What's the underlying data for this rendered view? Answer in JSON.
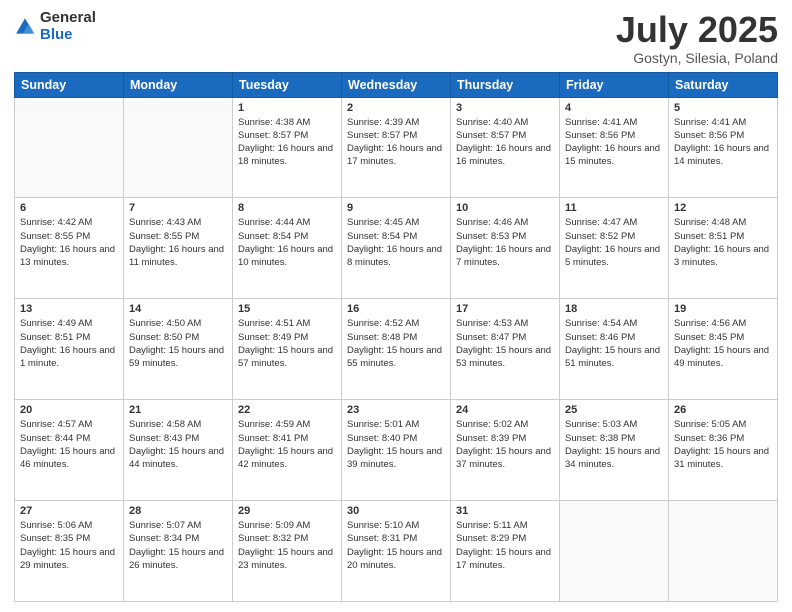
{
  "header": {
    "logo_general": "General",
    "logo_blue": "Blue",
    "month_title": "July 2025",
    "subtitle": "Gostyn, Silesia, Poland"
  },
  "weekdays": [
    "Sunday",
    "Monday",
    "Tuesday",
    "Wednesday",
    "Thursday",
    "Friday",
    "Saturday"
  ],
  "weeks": [
    [
      {
        "day": "",
        "detail": ""
      },
      {
        "day": "",
        "detail": ""
      },
      {
        "day": "1",
        "detail": "Sunrise: 4:38 AM\nSunset: 8:57 PM\nDaylight: 16 hours and 18 minutes."
      },
      {
        "day": "2",
        "detail": "Sunrise: 4:39 AM\nSunset: 8:57 PM\nDaylight: 16 hours and 17 minutes."
      },
      {
        "day": "3",
        "detail": "Sunrise: 4:40 AM\nSunset: 8:57 PM\nDaylight: 16 hours and 16 minutes."
      },
      {
        "day": "4",
        "detail": "Sunrise: 4:41 AM\nSunset: 8:56 PM\nDaylight: 16 hours and 15 minutes."
      },
      {
        "day": "5",
        "detail": "Sunrise: 4:41 AM\nSunset: 8:56 PM\nDaylight: 16 hours and 14 minutes."
      }
    ],
    [
      {
        "day": "6",
        "detail": "Sunrise: 4:42 AM\nSunset: 8:55 PM\nDaylight: 16 hours and 13 minutes."
      },
      {
        "day": "7",
        "detail": "Sunrise: 4:43 AM\nSunset: 8:55 PM\nDaylight: 16 hours and 11 minutes."
      },
      {
        "day": "8",
        "detail": "Sunrise: 4:44 AM\nSunset: 8:54 PM\nDaylight: 16 hours and 10 minutes."
      },
      {
        "day": "9",
        "detail": "Sunrise: 4:45 AM\nSunset: 8:54 PM\nDaylight: 16 hours and 8 minutes."
      },
      {
        "day": "10",
        "detail": "Sunrise: 4:46 AM\nSunset: 8:53 PM\nDaylight: 16 hours and 7 minutes."
      },
      {
        "day": "11",
        "detail": "Sunrise: 4:47 AM\nSunset: 8:52 PM\nDaylight: 16 hours and 5 minutes."
      },
      {
        "day": "12",
        "detail": "Sunrise: 4:48 AM\nSunset: 8:51 PM\nDaylight: 16 hours and 3 minutes."
      }
    ],
    [
      {
        "day": "13",
        "detail": "Sunrise: 4:49 AM\nSunset: 8:51 PM\nDaylight: 16 hours and 1 minute."
      },
      {
        "day": "14",
        "detail": "Sunrise: 4:50 AM\nSunset: 8:50 PM\nDaylight: 15 hours and 59 minutes."
      },
      {
        "day": "15",
        "detail": "Sunrise: 4:51 AM\nSunset: 8:49 PM\nDaylight: 15 hours and 57 minutes."
      },
      {
        "day": "16",
        "detail": "Sunrise: 4:52 AM\nSunset: 8:48 PM\nDaylight: 15 hours and 55 minutes."
      },
      {
        "day": "17",
        "detail": "Sunrise: 4:53 AM\nSunset: 8:47 PM\nDaylight: 15 hours and 53 minutes."
      },
      {
        "day": "18",
        "detail": "Sunrise: 4:54 AM\nSunset: 8:46 PM\nDaylight: 15 hours and 51 minutes."
      },
      {
        "day": "19",
        "detail": "Sunrise: 4:56 AM\nSunset: 8:45 PM\nDaylight: 15 hours and 49 minutes."
      }
    ],
    [
      {
        "day": "20",
        "detail": "Sunrise: 4:57 AM\nSunset: 8:44 PM\nDaylight: 15 hours and 46 minutes."
      },
      {
        "day": "21",
        "detail": "Sunrise: 4:58 AM\nSunset: 8:43 PM\nDaylight: 15 hours and 44 minutes."
      },
      {
        "day": "22",
        "detail": "Sunrise: 4:59 AM\nSunset: 8:41 PM\nDaylight: 15 hours and 42 minutes."
      },
      {
        "day": "23",
        "detail": "Sunrise: 5:01 AM\nSunset: 8:40 PM\nDaylight: 15 hours and 39 minutes."
      },
      {
        "day": "24",
        "detail": "Sunrise: 5:02 AM\nSunset: 8:39 PM\nDaylight: 15 hours and 37 minutes."
      },
      {
        "day": "25",
        "detail": "Sunrise: 5:03 AM\nSunset: 8:38 PM\nDaylight: 15 hours and 34 minutes."
      },
      {
        "day": "26",
        "detail": "Sunrise: 5:05 AM\nSunset: 8:36 PM\nDaylight: 15 hours and 31 minutes."
      }
    ],
    [
      {
        "day": "27",
        "detail": "Sunrise: 5:06 AM\nSunset: 8:35 PM\nDaylight: 15 hours and 29 minutes."
      },
      {
        "day": "28",
        "detail": "Sunrise: 5:07 AM\nSunset: 8:34 PM\nDaylight: 15 hours and 26 minutes."
      },
      {
        "day": "29",
        "detail": "Sunrise: 5:09 AM\nSunset: 8:32 PM\nDaylight: 15 hours and 23 minutes."
      },
      {
        "day": "30",
        "detail": "Sunrise: 5:10 AM\nSunset: 8:31 PM\nDaylight: 15 hours and 20 minutes."
      },
      {
        "day": "31",
        "detail": "Sunrise: 5:11 AM\nSunset: 8:29 PM\nDaylight: 15 hours and 17 minutes."
      },
      {
        "day": "",
        "detail": ""
      },
      {
        "day": "",
        "detail": ""
      }
    ]
  ]
}
